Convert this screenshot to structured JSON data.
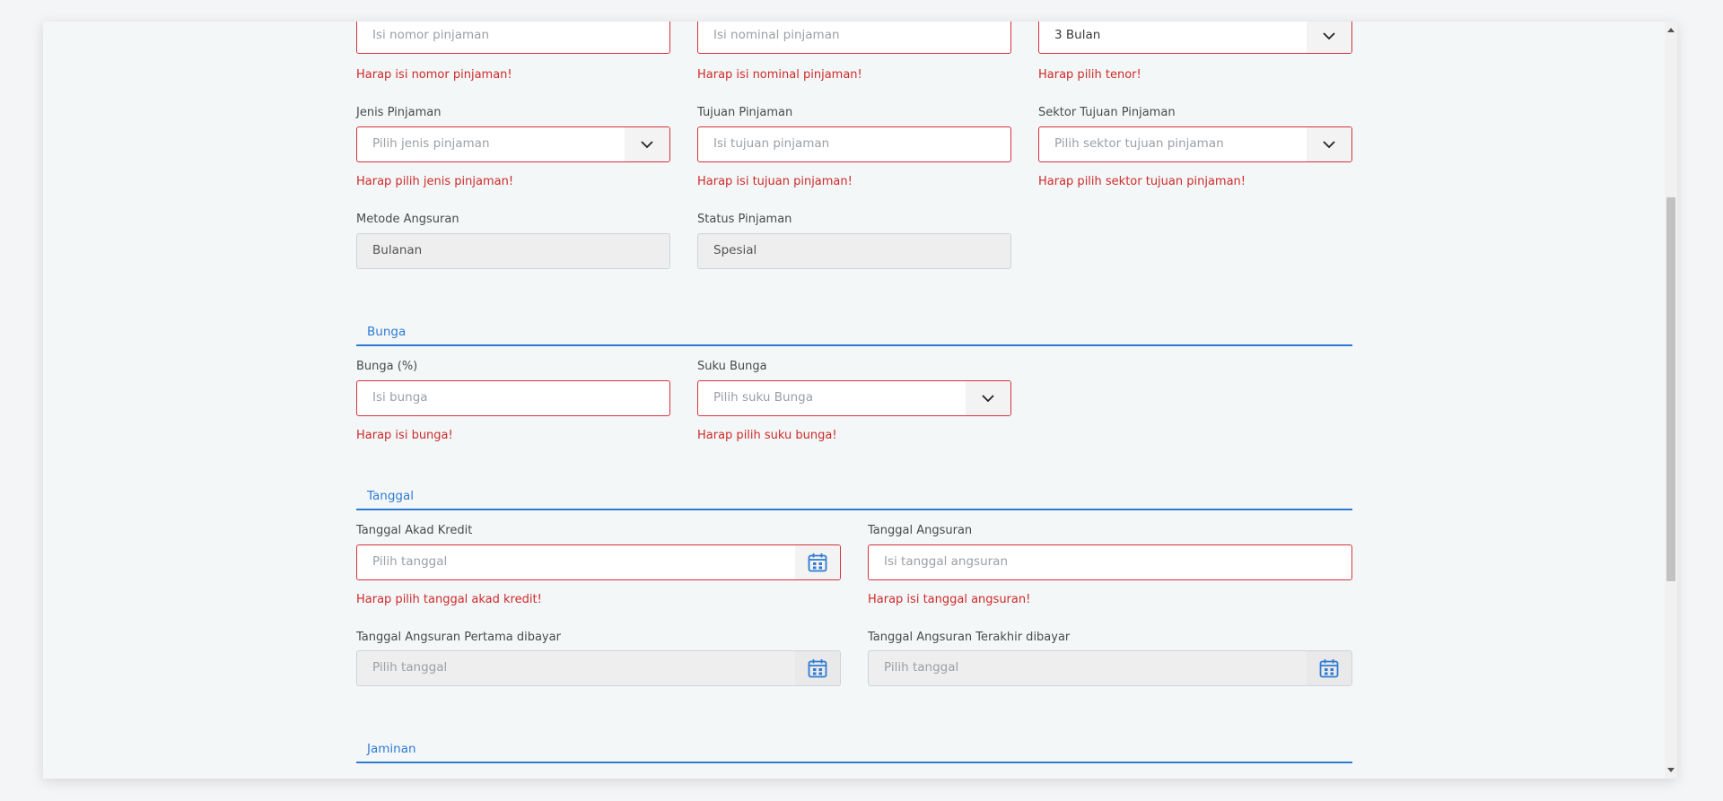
{
  "row1": {
    "nomor_pinjaman": {
      "placeholder": "Isi nomor pinjaman",
      "error": "Harap isi nomor pinjaman!"
    },
    "nominal_pinjaman": {
      "placeholder": "Isi nominal pinjaman",
      "error": "Harap isi nominal pinjaman!"
    },
    "tenor": {
      "value": "3 Bulan",
      "error": "Harap pilih tenor!"
    }
  },
  "row2": {
    "jenis_pinjaman": {
      "label": "Jenis Pinjaman",
      "placeholder": "Pilih jenis pinjaman",
      "error": "Harap pilih jenis pinjaman!"
    },
    "tujuan_pinjaman": {
      "label": "Tujuan Pinjaman",
      "placeholder": "Isi tujuan pinjaman",
      "error": "Harap isi tujuan pinjaman!"
    },
    "sektor_tujuan": {
      "label": "Sektor Tujuan Pinjaman",
      "placeholder": "Pilih sektor tujuan pinjaman",
      "error": "Harap pilih sektor tujuan pinjaman!"
    }
  },
  "row3": {
    "metode_angsuran": {
      "label": "Metode Angsuran",
      "value": "Bulanan"
    },
    "status_pinjaman": {
      "label": "Status Pinjaman",
      "value": "Spesial"
    }
  },
  "bunga": {
    "title": "Bunga",
    "bunga_persen": {
      "label": "Bunga (%)",
      "placeholder": "Isi bunga",
      "error": "Harap isi bunga!"
    },
    "suku_bunga": {
      "label": "Suku Bunga",
      "placeholder": "Pilih suku Bunga",
      "error": "Harap pilih suku bunga!"
    }
  },
  "tanggal": {
    "title": "Tanggal",
    "akad_kredit": {
      "label": "Tanggal Akad Kredit",
      "placeholder": "Pilih tanggal",
      "error": "Harap pilih tanggal akad kredit!"
    },
    "angsuran": {
      "label": "Tanggal Angsuran",
      "placeholder": "Isi tanggal angsuran",
      "error": "Harap isi tanggal angsuran!"
    },
    "angsuran_pertama": {
      "label": "Tanggal Angsuran Pertama dibayar",
      "placeholder": "Pilih tanggal"
    },
    "angsuran_terakhir": {
      "label": "Tanggal Angsuran Terakhir dibayar",
      "placeholder": "Pilih tanggal"
    }
  },
  "jaminan": {
    "title": "Jaminan"
  },
  "colors": {
    "error": "#cf2a2a",
    "accent": "#2f7bd4",
    "border_error": "#d7313d"
  },
  "icons": {
    "select": "chevron-down-icon",
    "date": "calendar-icon"
  }
}
